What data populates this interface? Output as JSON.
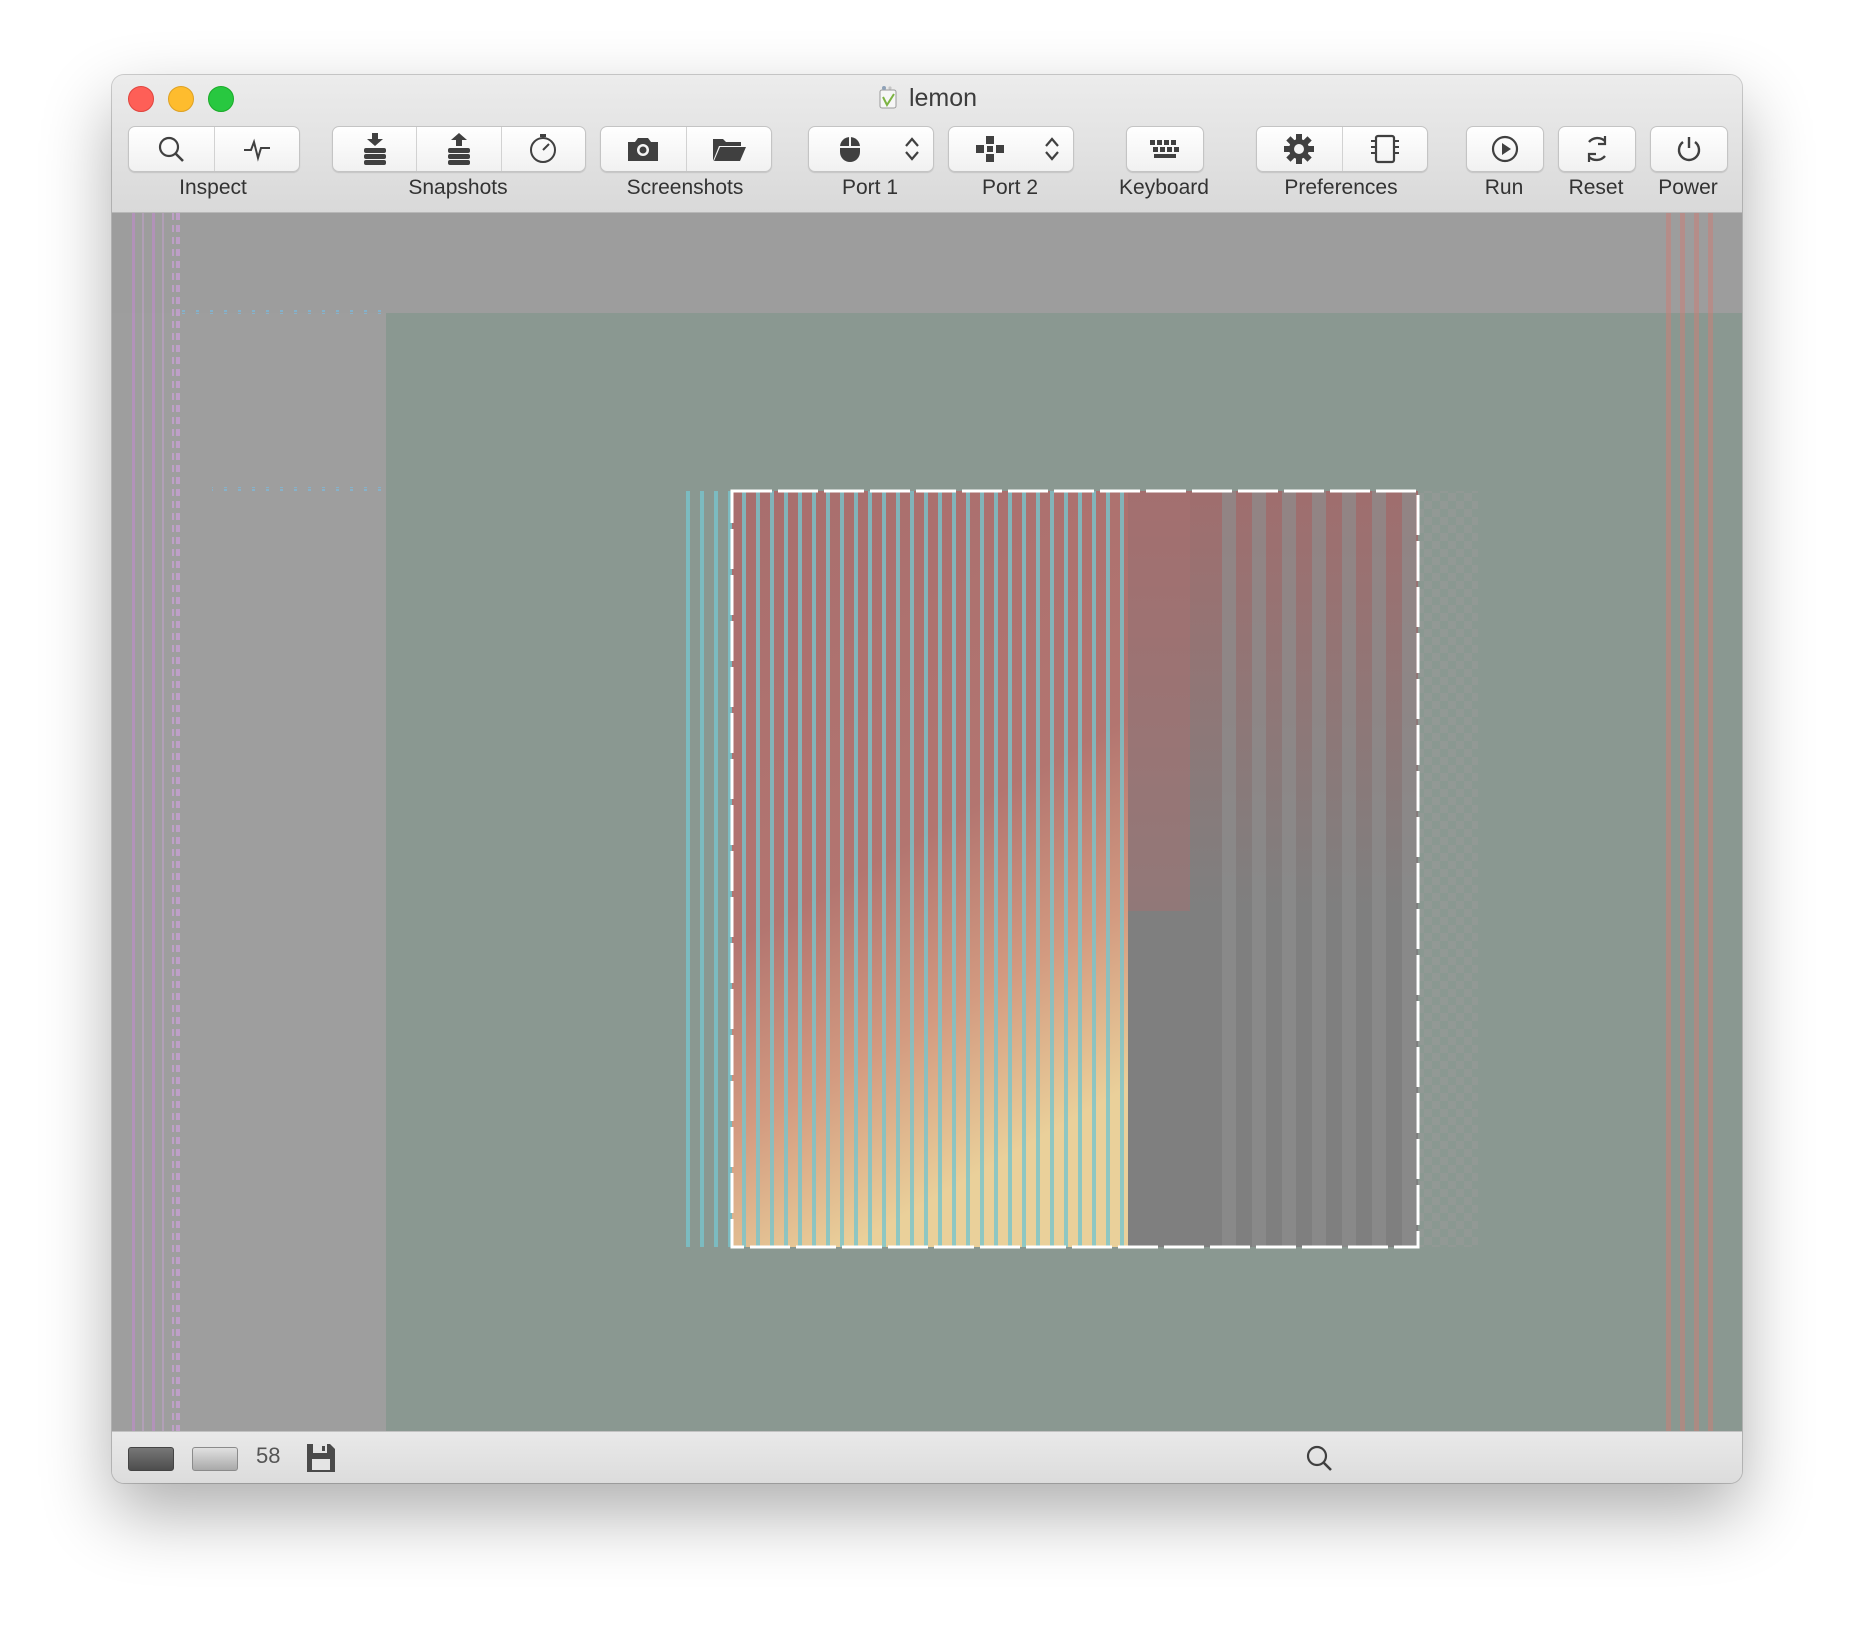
{
  "window": {
    "title": "lemon",
    "app_icon": "lemon-app-icon"
  },
  "toolbar": {
    "groups": [
      {
        "label": "Inspect",
        "icons": [
          "magnifier-icon",
          "activity-monitor-icon"
        ]
      },
      {
        "label": "Snapshots",
        "icons": [
          "take-snapshot-icon",
          "restore-snapshot-icon",
          "snapshot-timer-icon"
        ]
      },
      {
        "label": "Screenshots",
        "icons": [
          "camera-icon",
          "folder-icon"
        ]
      },
      {
        "label": "Port 1",
        "icons": [
          "mouse-icon",
          "updown-chevron-icon"
        ]
      },
      {
        "label": "Port 2",
        "icons": [
          "joystick-icon",
          "updown-chevron-icon"
        ]
      },
      {
        "label": "Keyboard",
        "icons": [
          "keyboard-icon"
        ]
      },
      {
        "label": "Preferences",
        "icons": [
          "gear-icon",
          "chip-icon"
        ]
      },
      {
        "label": "Run",
        "icons": [
          "play-icon"
        ]
      },
      {
        "label": "Reset",
        "icons": [
          "reset-icon"
        ]
      },
      {
        "label": "Power",
        "icons": [
          "power-icon"
        ]
      }
    ]
  },
  "statusbar": {
    "fps": "58",
    "icons": [
      "drive-1-icon",
      "drive-2-icon",
      "save-disk-icon",
      "magnifier-icon"
    ]
  },
  "colors": {
    "border_area": "#9e9e9e",
    "screen_background": "#8a9891",
    "sprite_gradient_top": "#a86e6e",
    "sprite_gradient_bottom": "#ead09a",
    "sprite_gray": "#7f7f7f",
    "cyan_stripes": "#78c4cc",
    "red_stripes": "#c88078",
    "purple_stripes": "#b98ec3"
  }
}
